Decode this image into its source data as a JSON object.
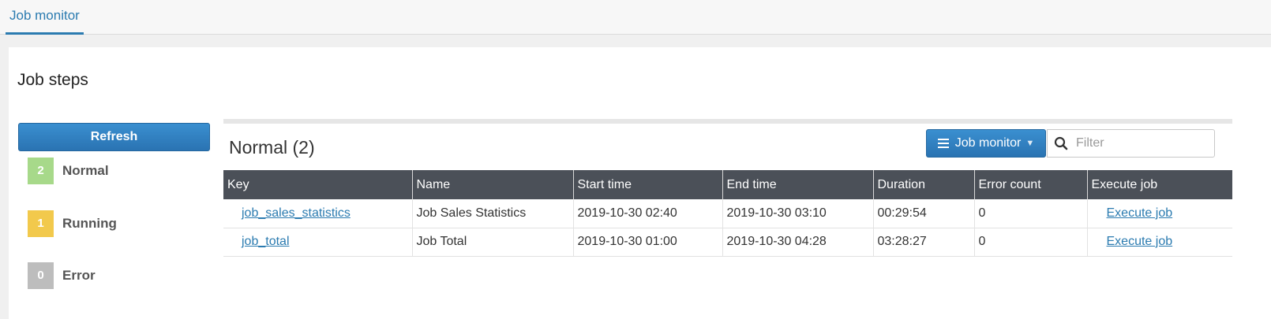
{
  "top_tabs": [
    {
      "label": "Job monitor"
    }
  ],
  "panel": {
    "title": "Job steps"
  },
  "sidebar": {
    "refresh_label": "Refresh",
    "statuses": [
      {
        "count": "2",
        "label": "Normal",
        "color": "#a7d98a"
      },
      {
        "count": "1",
        "label": "Running",
        "color": "#f2c94c"
      },
      {
        "count": "0",
        "label": "Error",
        "color": "#bdbdbd"
      }
    ]
  },
  "main": {
    "heading": "Normal (2)",
    "view_button_label": "Job monitor",
    "filter_placeholder": "Filter",
    "table": {
      "columns": [
        "Key",
        "Name",
        "Start time",
        "End time",
        "Duration",
        "Error count",
        "Execute job"
      ],
      "rows": [
        {
          "key": "job_sales_statistics",
          "name": "Job Sales Statistics",
          "start": "2019-10-30 02:40",
          "end": "2019-10-30 03:10",
          "duration": "00:29:54",
          "errors": "0",
          "action": "Execute job"
        },
        {
          "key": "job_total",
          "name": "Job Total",
          "start": "2019-10-30 01:00",
          "end": "2019-10-30 04:28",
          "duration": "03:28:27",
          "errors": "0",
          "action": "Execute job"
        }
      ]
    }
  },
  "colors": {
    "accent": "#2b7bb0",
    "header_bg": "#4b5058"
  }
}
